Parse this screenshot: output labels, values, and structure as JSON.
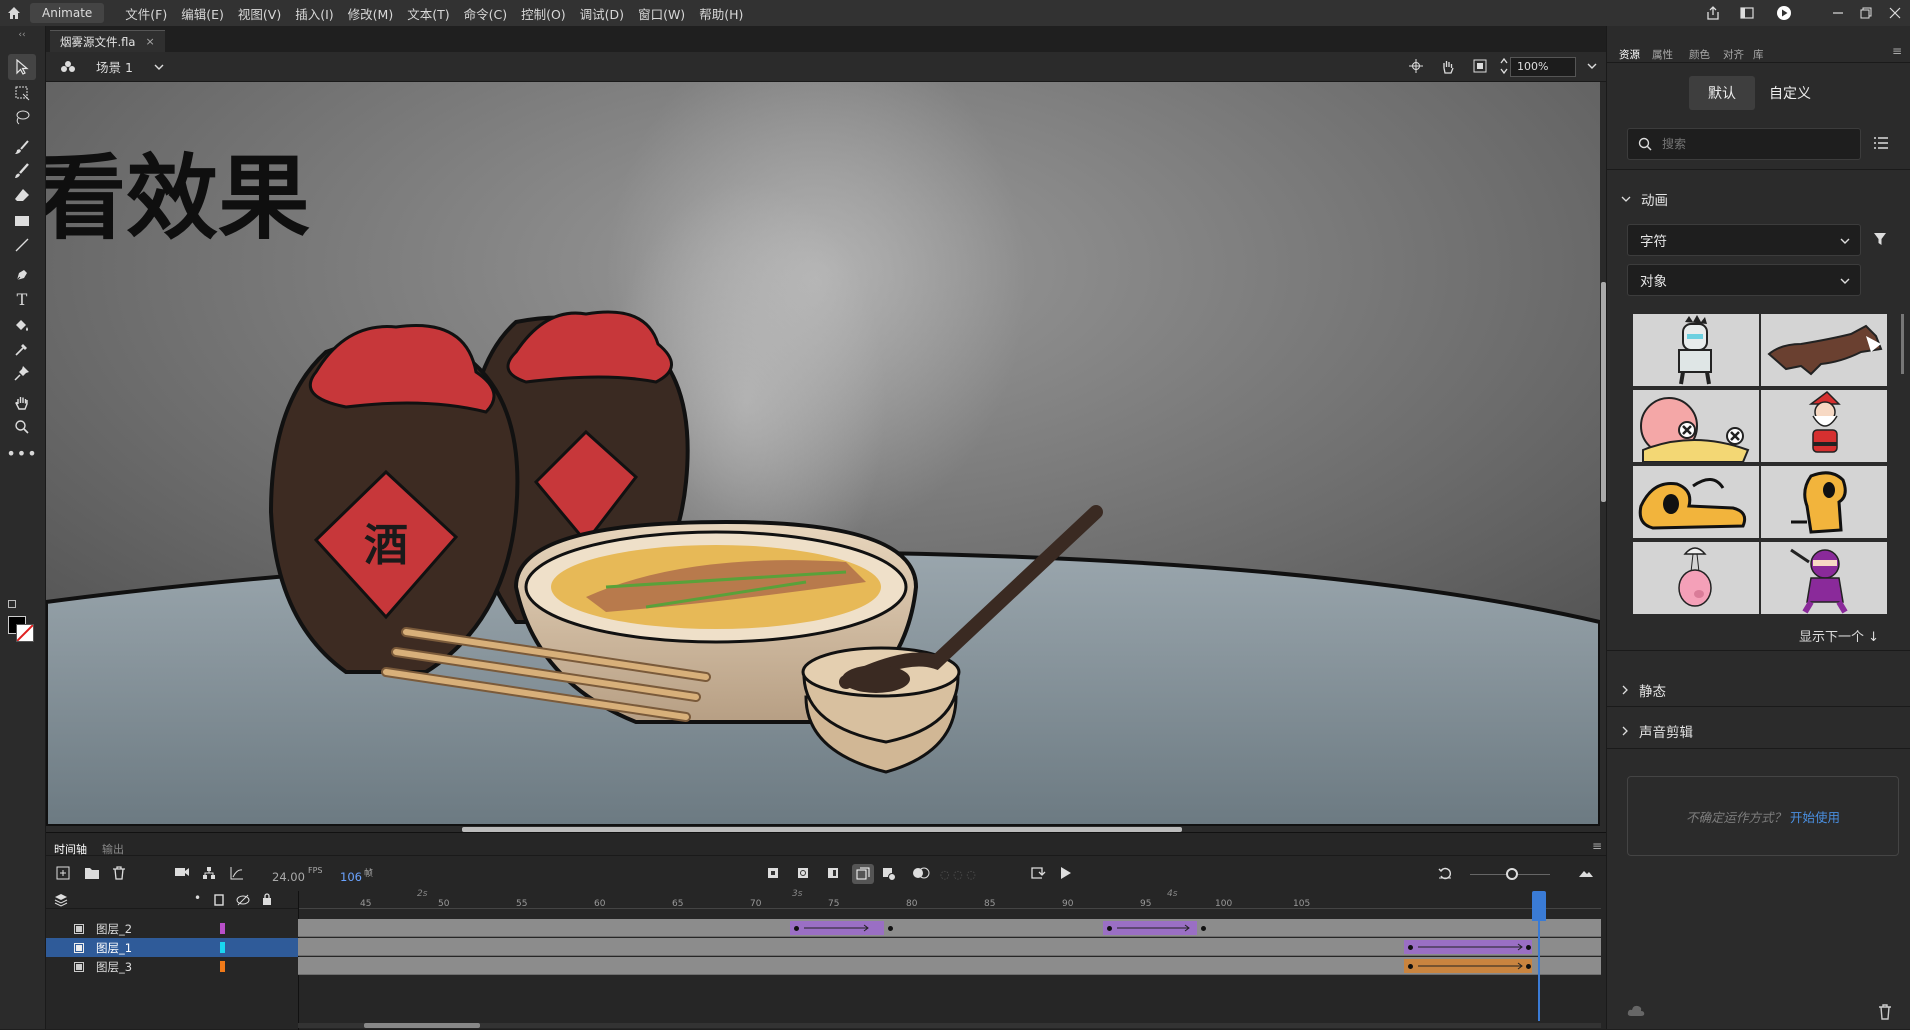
{
  "menubar": {
    "app_name": "Animate",
    "items": [
      "文件(F)",
      "编辑(E)",
      "视图(V)",
      "插入(I)",
      "修改(M)",
      "文本(T)",
      "命令(C)",
      "控制(O)",
      "调试(D)",
      "窗口(W)",
      "帮助(H)"
    ]
  },
  "document": {
    "tab_title": "烟雾源文件.fla",
    "scene_label": "场景 1",
    "zoom": "100%"
  },
  "stage": {
    "overlay_text": "看效果",
    "jar_label": "酒"
  },
  "right_panel": {
    "tabs": [
      "资源",
      "属性",
      "颜色",
      "对齐",
      "库"
    ],
    "seg_default": "默认",
    "seg_custom": "自定义",
    "search_placeholder": "搜索",
    "section_animation": "动画",
    "dropdown_1": "字符",
    "dropdown_2": "对象",
    "show_next": "显示下一个 ↓",
    "section_static": "静态",
    "section_sound": "声音剪辑",
    "help_text": "不确定运作方式？",
    "help_link": "开始使用"
  },
  "timeline": {
    "tab_timeline": "时间轴",
    "tab_output": "输出",
    "fps": "24.00",
    "fps_unit": "FPS",
    "frame": "106",
    "frame_unit": "帧",
    "seconds": [
      "2s",
      "3s",
      "4s"
    ],
    "ruler": [
      "45",
      "50",
      "55",
      "60",
      "65",
      "70",
      "75",
      "80",
      "85",
      "90",
      "95",
      "100",
      "105"
    ],
    "layers": [
      {
        "name": "图层_2",
        "color": "#b84fc9"
      },
      {
        "name": "图层_1",
        "color": "#19d6f0"
      },
      {
        "name": "图层_3",
        "color": "#f07a19"
      }
    ]
  },
  "colors": {
    "accent": "#2d6cc0",
    "tween_purple": "#9a6fc4",
    "tween_orange": "#c9843f"
  }
}
